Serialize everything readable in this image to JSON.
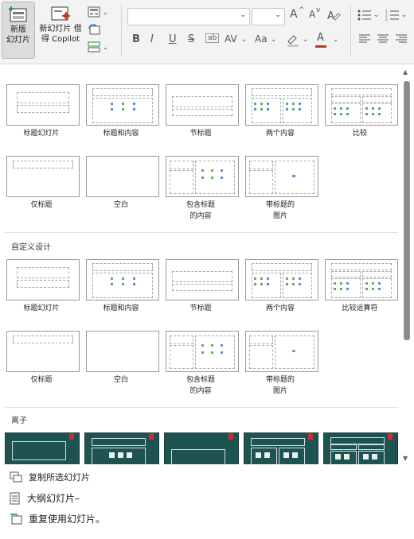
{
  "ribbon": {
    "new_slide": {
      "line1": "新版",
      "line2": "幻灯片"
    },
    "copilot": {
      "line1": "新幻灯片 借",
      "line2": "得 Copilot"
    },
    "font_labels": {
      "bold": "B",
      "italic": "I",
      "underline": "U",
      "strike": "S",
      "spacing": "AV",
      "case": "Aa",
      "grow": "A",
      "shrink": "A",
      "font_color": "A"
    }
  },
  "gallery": {
    "sections": [
      {
        "label": ""
      },
      {
        "label": "自定义设计"
      },
      {
        "label": "离子"
      }
    ],
    "office_layouts": [
      "标题幻灯片",
      "标题和内容",
      "节标题",
      "两个内容",
      "比较",
      "仅标题",
      "空白",
      "包含标题",
      "的内容",
      "带标题的",
      "图片"
    ],
    "custom_layouts": [
      "标题幻灯片",
      "标题和内容",
      "节标题",
      "两个内容",
      "比较运算符",
      "仅标题",
      "空白",
      "包含标题",
      "的内容",
      "带标题的",
      "图片"
    ]
  },
  "menu": {
    "duplicate": "复制所选幻灯片",
    "outline": "大纲幻灯片–",
    "reuse": "重复使用幻灯片。"
  },
  "colors": {
    "dot_green": "#6aa86a",
    "dot_blue": "#5b8fd1",
    "ion_bg": "#1f5351",
    "ion_accent": "#c9302c"
  }
}
